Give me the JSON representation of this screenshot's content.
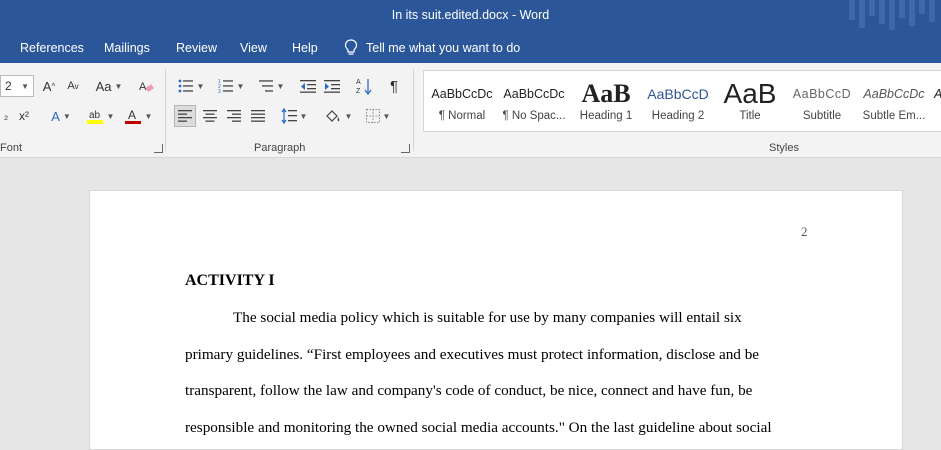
{
  "window": {
    "title": "In its suit.edited.docx  -  Word"
  },
  "tabs": [
    "References",
    "Mailings",
    "Review",
    "View",
    "Help"
  ],
  "tell_me": "Tell me what you want to do",
  "font_group": {
    "size_value": "2",
    "label": "Font",
    "grow": "A",
    "shrink": "A",
    "case": "Aa"
  },
  "paragraph_group": {
    "label": "Paragraph"
  },
  "styles_group": {
    "label": "Styles",
    "items": [
      {
        "preview": "AaBbCcDc",
        "name": "¶ Normal"
      },
      {
        "preview": "AaBbCcDc",
        "name": "¶ No Spac..."
      },
      {
        "preview": "AaB",
        "name": "Heading 1"
      },
      {
        "preview": "AaBbCcD",
        "name": "Heading 2"
      },
      {
        "preview": "AaB",
        "name": "Title"
      },
      {
        "preview": "AaBbCcD",
        "name": "Subtitle"
      },
      {
        "preview": "AaBbCcDc",
        "name": "Subtle Em..."
      },
      {
        "preview": "A",
        "name": ""
      }
    ]
  },
  "document": {
    "page_number": "2",
    "heading": "ACTIVITY I",
    "lines": [
      "The social media policy which is suitable for use by many companies will entail six",
      "primary guidelines. “First employees and executives must protect information, disclose and be",
      "transparent, follow the law and company's code of conduct, be nice, connect and have fun, be",
      "responsible and monitoring the owned social media accounts.\"  On the last guideline about social"
    ]
  },
  "colors": {
    "title_bar": "#2b579a",
    "highlight": "#ffff00",
    "font_color": "#c00000"
  }
}
